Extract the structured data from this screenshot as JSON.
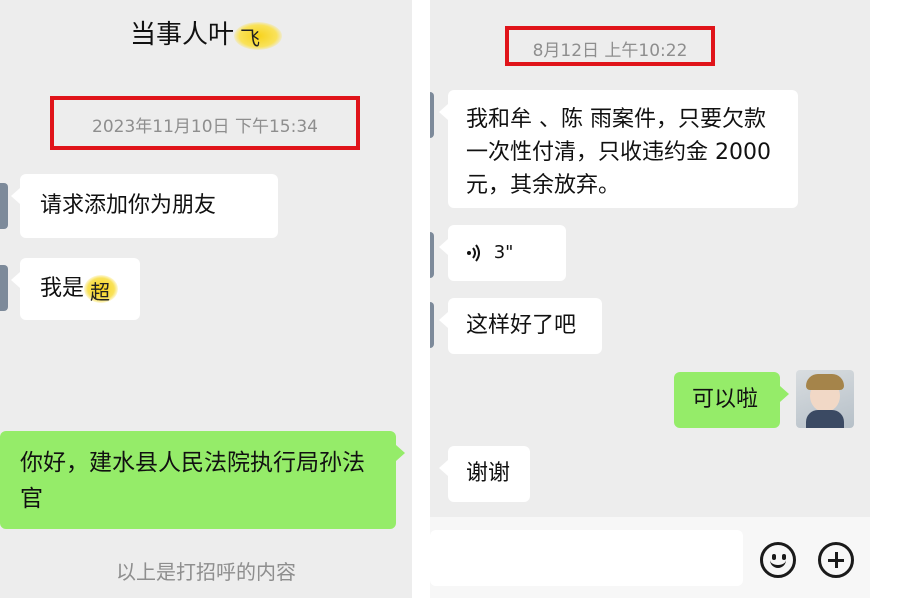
{
  "left": {
    "title": "当事人叶",
    "title_scribble": "飞",
    "timestamp": "2023年11月10日 下午15:34",
    "messages": [
      {
        "text": "请求添加你为朋友"
      },
      {
        "text": "我是",
        "scribble": "超"
      },
      {
        "text": "你好，建水县人民法院执行局孙法官"
      }
    ],
    "footnote": "以上是打招呼的内容"
  },
  "right": {
    "timestamp": "8月12日 上午10:22",
    "messages": [
      {
        "text": "我和牟 、陈 雨案件，只要欠款一次性付清，只收违约金 2000 元，其余放弃。"
      },
      {
        "voice_duration": "3\""
      },
      {
        "text": "这样好了吧"
      },
      {
        "text": "可以啦"
      },
      {
        "text": "谢谢"
      }
    ]
  },
  "colors": {
    "chat_bg": "#ededed",
    "bubble_white": "#ffffff",
    "bubble_green": "#95ec69",
    "highlight_red": "#e0141a",
    "timestamp_gray": "#8e8e8e"
  },
  "icons": [
    "voice-icon",
    "emoji-icon",
    "plus-icon",
    "avatar"
  ]
}
